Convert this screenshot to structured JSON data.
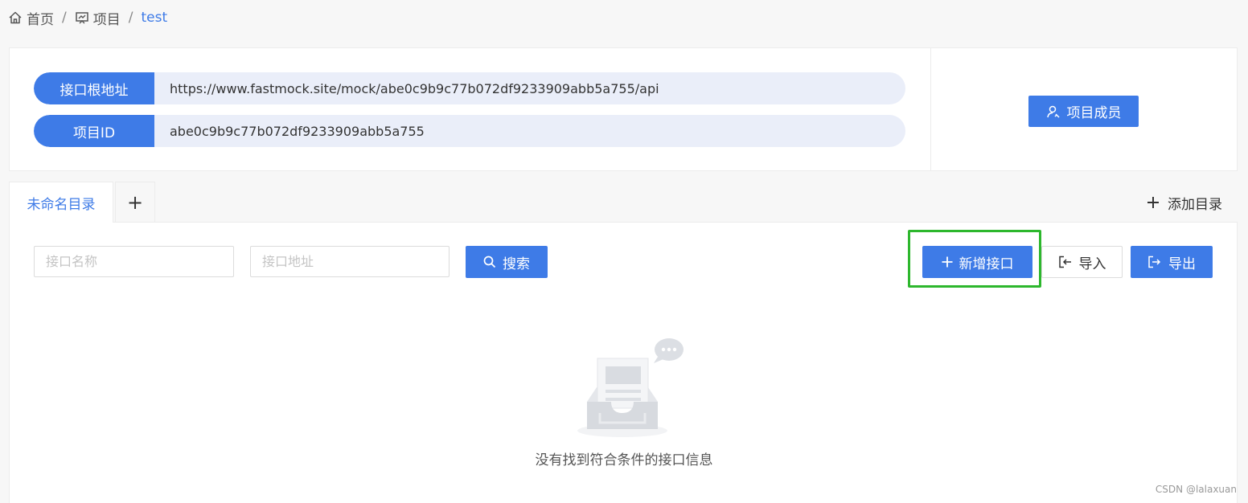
{
  "breadcrumb": {
    "home": "首页",
    "project": "项目",
    "current": "test"
  },
  "project_info": {
    "base_url_label": "接口根地址",
    "base_url": "https://www.fastmock.site/mock/abe0c9b9c77b072df9233909abb5a755/api",
    "project_id_label": "项目ID",
    "project_id": "abe0c9b9c77b072df9233909abb5a755",
    "members_button": "项目成员"
  },
  "tabs": {
    "active": "未命名目录",
    "add_tab": "+",
    "add_directory": "添加目录"
  },
  "toolbar": {
    "name_placeholder": "接口名称",
    "name_value": "",
    "url_placeholder": "接口地址",
    "url_value": "",
    "search_button": "搜索",
    "new_api_button": "新增接口",
    "import_button": "导入",
    "export_button": "导出"
  },
  "empty_state": {
    "message": "没有找到符合条件的接口信息"
  },
  "watermark": "CSDN @lalaxuan",
  "colors": {
    "primary": "#3e7be7",
    "highlight": "#2db72d",
    "pill_bg": "#eaeef9"
  }
}
